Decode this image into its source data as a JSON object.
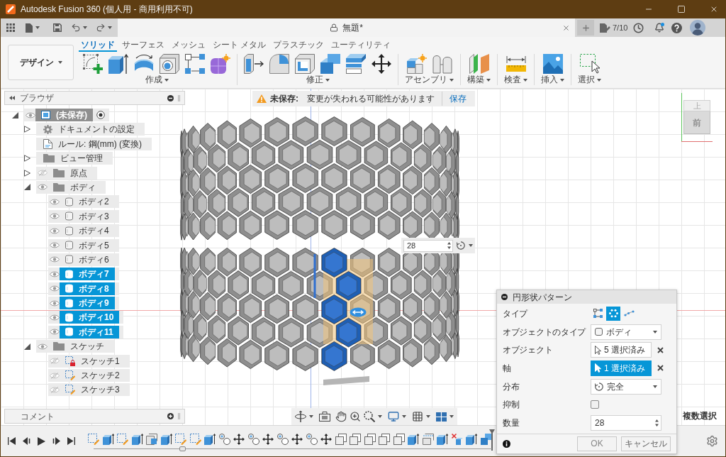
{
  "window": {
    "title": "Autodesk Fusion 360 (個人用 - 商用利用不可)"
  },
  "document_tab": {
    "title": "無題*"
  },
  "jobs": {
    "count": "7/10"
  },
  "workspace": {
    "label": "デザイン"
  },
  "tabs": [
    {
      "label": "ソリッド",
      "selected": true
    },
    {
      "label": "サーフェス",
      "selected": false
    },
    {
      "label": "メッシュ",
      "selected": false
    },
    {
      "label": "シート メタル",
      "selected": false
    },
    {
      "label": "プラスチック",
      "selected": false
    },
    {
      "label": "ユーティリティ",
      "selected": false
    }
  ],
  "tool_groups": [
    {
      "label": "作成"
    },
    {
      "label": "修正"
    },
    {
      "label": "アセンブリ"
    },
    {
      "label": "構築"
    },
    {
      "label": "検査"
    },
    {
      "label": "挿入"
    },
    {
      "label": "選択"
    }
  ],
  "browser": {
    "title": "ブラウザ",
    "tree": [
      {
        "label": "(未保存)",
        "kind": "component",
        "expanded": true,
        "visible": true,
        "selected": false,
        "children": [
          {
            "label": "ドキュメントの設定",
            "kind": "settings",
            "expanded": false,
            "selected": false
          },
          {
            "label": "ルール: 鋼(mm) (変換)",
            "kind": "rule",
            "selected": false
          },
          {
            "label": "ビュー管理",
            "kind": "folder",
            "expanded": false,
            "selected": false
          },
          {
            "label": "原点",
            "kind": "folder",
            "expanded": false,
            "visible": false,
            "selected": false
          },
          {
            "label": "ボディ",
            "kind": "folder",
            "expanded": true,
            "visible": true,
            "selected": false,
            "children": [
              {
                "label": "ボディ2",
                "kind": "body",
                "visible": true,
                "selected": false
              },
              {
                "label": "ボディ3",
                "kind": "body",
                "visible": true,
                "selected": false
              },
              {
                "label": "ボディ4",
                "kind": "body",
                "visible": true,
                "selected": false
              },
              {
                "label": "ボディ5",
                "kind": "body",
                "visible": true,
                "selected": false
              },
              {
                "label": "ボディ6",
                "kind": "body",
                "visible": true,
                "selected": false
              },
              {
                "label": "ボディ7",
                "kind": "body",
                "visible": true,
                "selected": true
              },
              {
                "label": "ボディ8",
                "kind": "body",
                "visible": true,
                "selected": true
              },
              {
                "label": "ボディ9",
                "kind": "body",
                "visible": true,
                "selected": true
              },
              {
                "label": "ボディ10",
                "kind": "body",
                "visible": true,
                "selected": true
              },
              {
                "label": "ボディ11",
                "kind": "body",
                "visible": true,
                "selected": true
              }
            ]
          },
          {
            "label": "スケッチ",
            "kind": "folder",
            "expanded": true,
            "visible": true,
            "selected": false,
            "children": [
              {
                "label": "スケッチ1",
                "kind": "sketch",
                "visible": false,
                "locked": true,
                "selected": false
              },
              {
                "label": "スケッチ2",
                "kind": "sketch",
                "visible": false,
                "locked": false,
                "selected": false
              },
              {
                "label": "スケッチ3",
                "kind": "sketch",
                "visible": false,
                "locked": false,
                "selected": false
              }
            ]
          }
        ]
      }
    ]
  },
  "comments": {
    "title": "コメント"
  },
  "banner": {
    "label": "未保存:",
    "message": "変更が失われる可能性があります",
    "action": "保存"
  },
  "view_cube": {
    "top": "上",
    "front": "前"
  },
  "canvas_input": {
    "value": "28"
  },
  "dialog": {
    "title": "円形状パターン",
    "type": {
      "label": "タイプ",
      "options": [
        {
          "selected": false
        },
        {
          "selected": true
        },
        {
          "selected": false
        }
      ]
    },
    "object_type": {
      "label": "オブジェクトのタイプ",
      "value": "ボディ"
    },
    "objects": {
      "label": "オブジェクト",
      "value": "5 選択済み",
      "active": false
    },
    "axis": {
      "label": "軸",
      "value": "1 選択済み",
      "active": true
    },
    "distribution": {
      "label": "分布",
      "value": "完全"
    },
    "suppress": {
      "label": "抑制",
      "checked": false
    },
    "quantity": {
      "label": "数量",
      "value": "28"
    },
    "ok": "OK",
    "cancel": "キャンセル"
  },
  "selection_mode": {
    "label": "複数選択"
  }
}
